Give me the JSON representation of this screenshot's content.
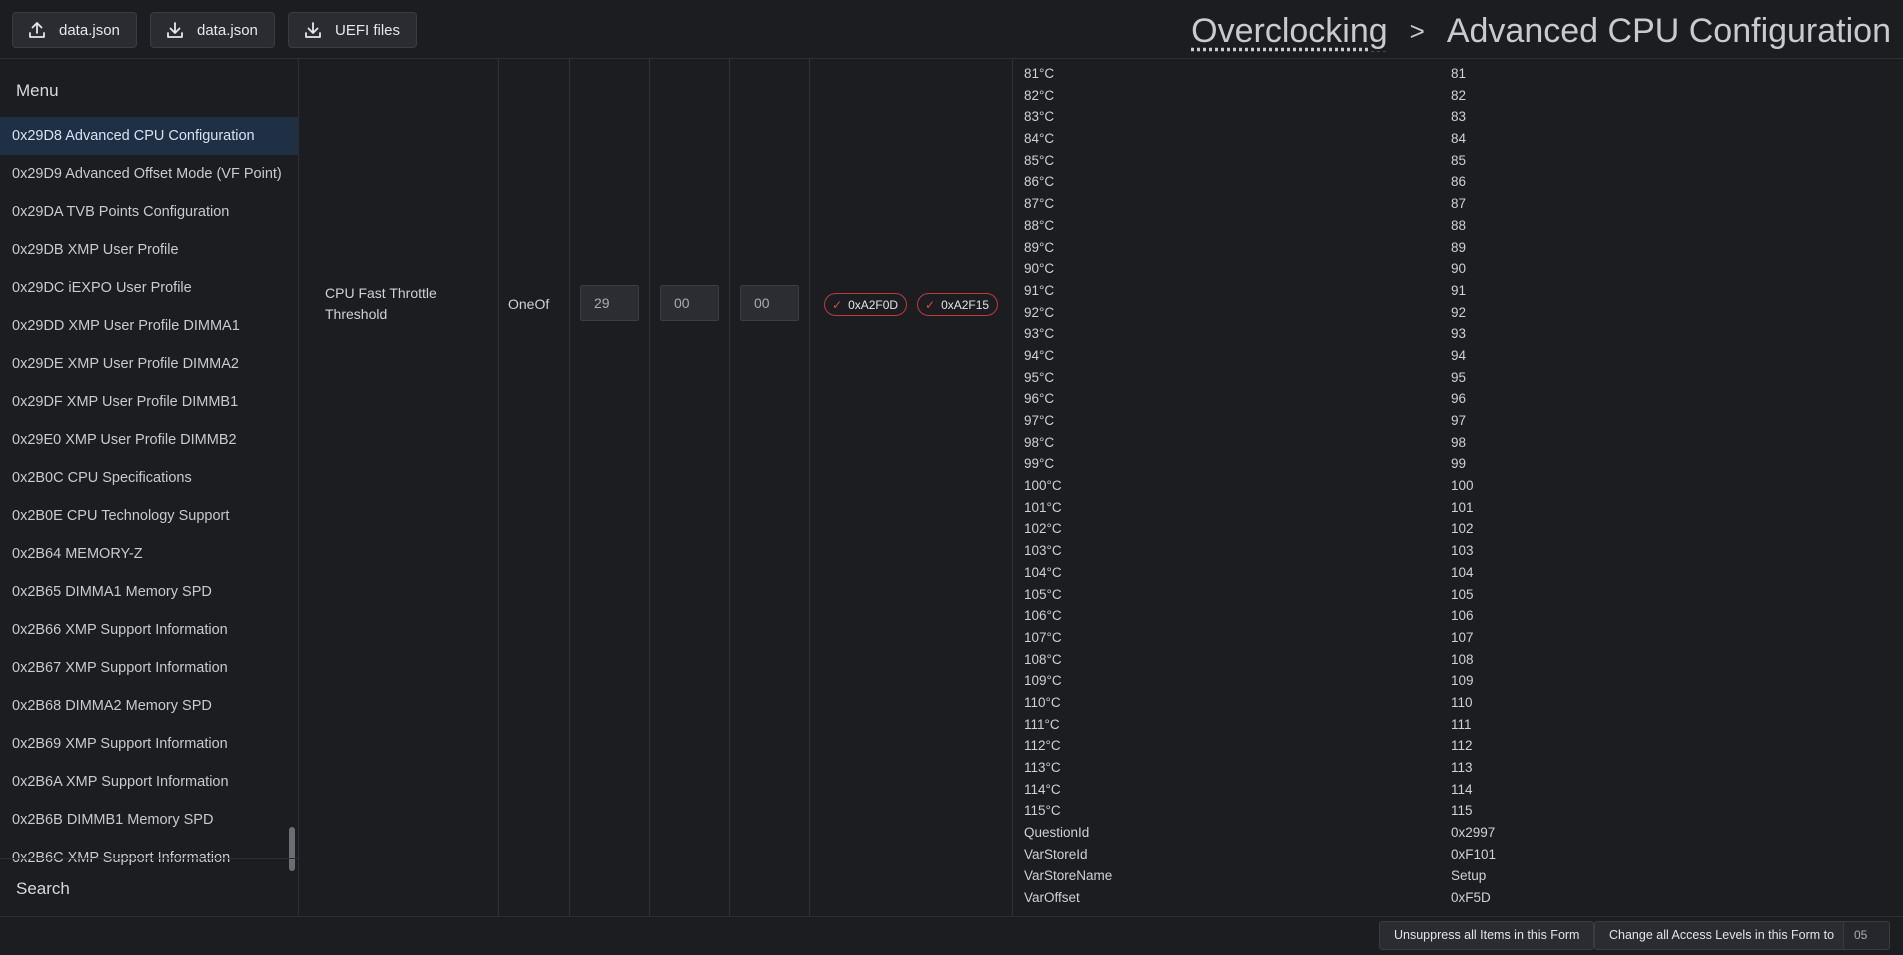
{
  "toolbar": {
    "upload_label": "data.json",
    "download_label": "data.json",
    "uefi_label": "UEFI files"
  },
  "breadcrumb": {
    "parent": "Overclocking",
    "separator": ">",
    "current": "Advanced CPU Configuration"
  },
  "sidebar": {
    "title": "Menu",
    "search_label": "Search",
    "items": [
      "0x29D8 Advanced CPU Configuration",
      "0x29D9 Advanced Offset Mode (VF Point)",
      "0x29DA TVB Points Configuration",
      "0x29DB XMP User Profile",
      "0x29DC iEXPO User Profile",
      "0x29DD XMP User Profile DIMMA1",
      "0x29DE XMP User Profile DIMMA2",
      "0x29DF XMP User Profile DIMMB1",
      "0x29E0 XMP User Profile DIMMB2",
      "0x2B0C CPU Specifications",
      "0x2B0E CPU Technology Support",
      "0x2B64 MEMORY-Z",
      "0x2B65 DIMMA1 Memory SPD",
      "0x2B66 XMP Support Information",
      "0x2B67 XMP Support Information",
      "0x2B68 DIMMA2 Memory SPD",
      "0x2B69 XMP Support Information",
      "0x2B6A XMP Support Information",
      "0x2B6B DIMMB1 Memory SPD",
      "0x2B6C XMP Support Information"
    ]
  },
  "question": {
    "name": "CPU Fast Throttle Threshold",
    "type": "OneOf",
    "field1": "29",
    "field2": "00",
    "field3": "00",
    "ref1": "0xA2F0D",
    "ref2": "0xA2F15"
  },
  "options": [
    {
      "k": "81°C",
      "v": "81"
    },
    {
      "k": "82°C",
      "v": "82"
    },
    {
      "k": "83°C",
      "v": "83"
    },
    {
      "k": "84°C",
      "v": "84"
    },
    {
      "k": "85°C",
      "v": "85"
    },
    {
      "k": "86°C",
      "v": "86"
    },
    {
      "k": "87°C",
      "v": "87"
    },
    {
      "k": "88°C",
      "v": "88"
    },
    {
      "k": "89°C",
      "v": "89"
    },
    {
      "k": "90°C",
      "v": "90"
    },
    {
      "k": "91°C",
      "v": "91"
    },
    {
      "k": "92°C",
      "v": "92"
    },
    {
      "k": "93°C",
      "v": "93"
    },
    {
      "k": "94°C",
      "v": "94"
    },
    {
      "k": "95°C",
      "v": "95"
    },
    {
      "k": "96°C",
      "v": "96"
    },
    {
      "k": "97°C",
      "v": "97"
    },
    {
      "k": "98°C",
      "v": "98"
    },
    {
      "k": "99°C",
      "v": "99"
    },
    {
      "k": "100°C",
      "v": "100"
    },
    {
      "k": "101°C",
      "v": "101"
    },
    {
      "k": "102°C",
      "v": "102"
    },
    {
      "k": "103°C",
      "v": "103"
    },
    {
      "k": "104°C",
      "v": "104"
    },
    {
      "k": "105°C",
      "v": "105"
    },
    {
      "k": "106°C",
      "v": "106"
    },
    {
      "k": "107°C",
      "v": "107"
    },
    {
      "k": "108°C",
      "v": "108"
    },
    {
      "k": "109°C",
      "v": "109"
    },
    {
      "k": "110°C",
      "v": "110"
    },
    {
      "k": "111°C",
      "v": "111"
    },
    {
      "k": "112°C",
      "v": "112"
    },
    {
      "k": "113°C",
      "v": "113"
    },
    {
      "k": "114°C",
      "v": "114"
    },
    {
      "k": "115°C",
      "v": "115"
    },
    {
      "k": "QuestionId",
      "v": "0x2997"
    },
    {
      "k": "VarStoreId",
      "v": "0xF101"
    },
    {
      "k": "VarStoreName",
      "v": "Setup"
    },
    {
      "k": "VarOffset",
      "v": "0xF5D"
    }
  ],
  "footer": {
    "unsuppress_label": "Unsuppress all Items in this Form",
    "change_access_label": "Change all Access Levels in this Form to",
    "access_level_value": "05"
  },
  "colors": {
    "background": "#1c1d21",
    "active_item": "#1f3045",
    "pill_border": "#c03a3a"
  }
}
